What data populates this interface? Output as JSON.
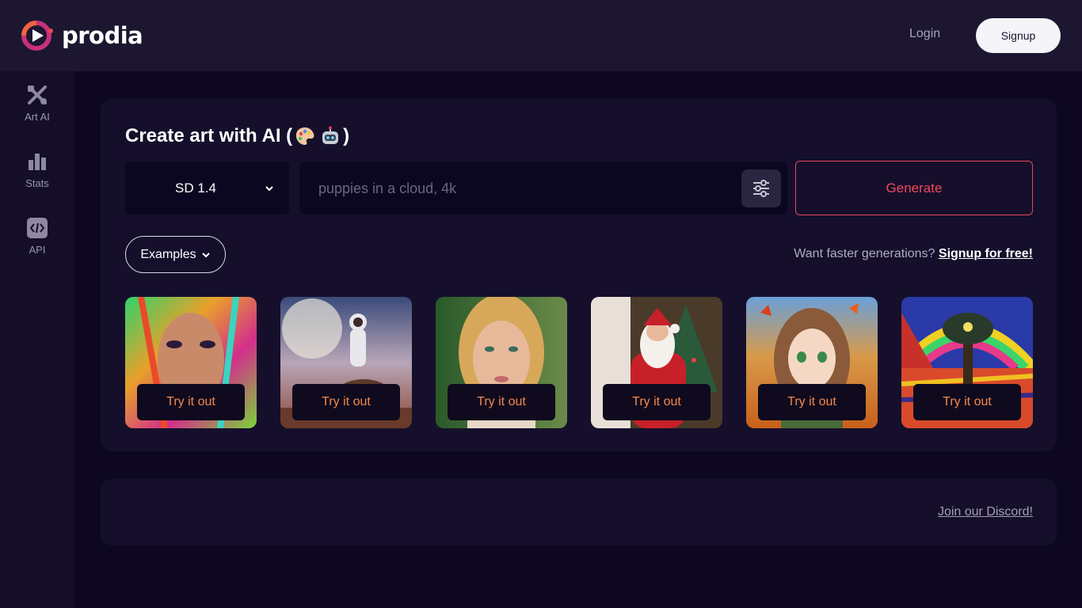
{
  "brand": {
    "name": "prodia",
    "accent": "#e8475b",
    "accent2": "#b82a86"
  },
  "header": {
    "login_label": "Login",
    "signup_label": "Signup"
  },
  "sidebar": {
    "items": [
      {
        "label": "Art AI",
        "icon": "crossed-tools-icon"
      },
      {
        "label": "Stats",
        "icon": "bar-chart-icon"
      },
      {
        "label": "API",
        "icon": "code-icon"
      }
    ]
  },
  "main": {
    "title": "Create art with AI (",
    "title_close": ")",
    "title_icons": [
      "palette-emoji-icon",
      "robot-emoji-icon"
    ],
    "model": {
      "selected": "SD 1.4"
    },
    "prompt": {
      "placeholder": "puppies in a cloud, 4k",
      "value": ""
    },
    "generate_label": "Generate",
    "examples_label": "Examples",
    "faster_text": "Want faster generations?",
    "faster_link": "Signup for free!",
    "gallery": [
      {
        "subject": "colorful-portrait-woman",
        "button": "Try it out"
      },
      {
        "subject": "astronaut-on-horse",
        "button": "Try it out"
      },
      {
        "subject": "blonde-woman-portrait",
        "button": "Try it out"
      },
      {
        "subject": "santa-claus",
        "button": "Try it out"
      },
      {
        "subject": "anime-girl-autumn",
        "button": "Try it out"
      },
      {
        "subject": "psychedelic-tree-landscape",
        "button": "Try it out"
      }
    ]
  },
  "footer": {
    "discord_label": "Join our Discord!"
  }
}
